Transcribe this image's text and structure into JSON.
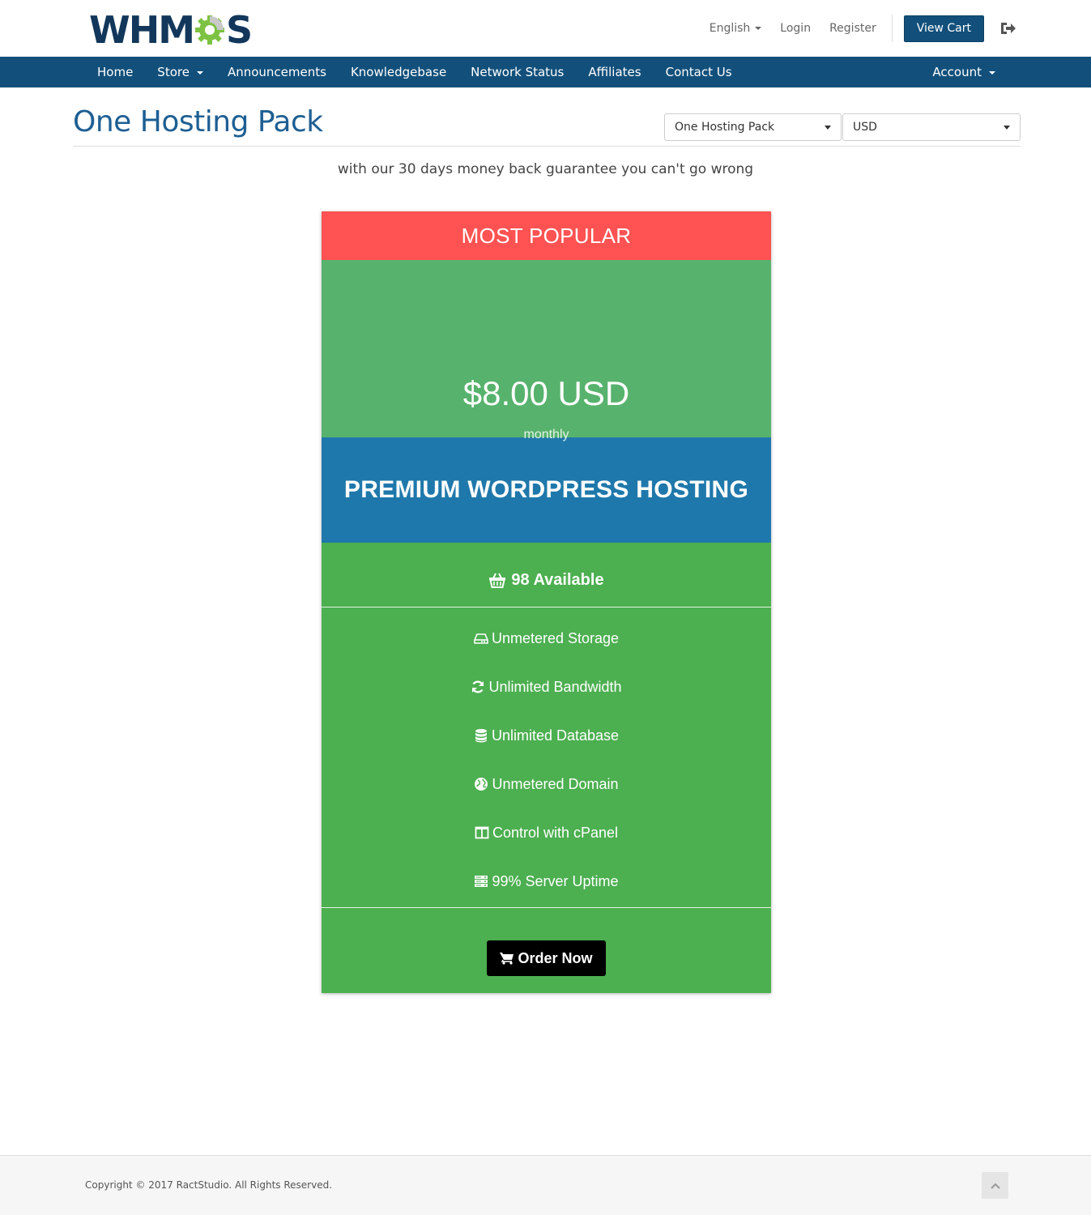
{
  "header": {
    "logo_text_left": "WHM",
    "logo_text_right": "S",
    "language": "English",
    "login": "Login",
    "register": "Register",
    "view_cart": "View Cart"
  },
  "nav": {
    "items": [
      {
        "label": "Home"
      },
      {
        "label": "Store"
      },
      {
        "label": "Announcements"
      },
      {
        "label": "Knowledgebase"
      },
      {
        "label": "Network Status"
      },
      {
        "label": "Affiliates"
      },
      {
        "label": "Contact Us"
      }
    ],
    "account": "Account"
  },
  "page": {
    "title": "One Hosting Pack",
    "group_select": "One Hosting Pack",
    "currency_select": "USD",
    "tagline": "with our 30 days money back guarantee you can't go wrong"
  },
  "product": {
    "badge": "MOST POPULAR",
    "price": "$8.00 USD",
    "cycle": "monthly",
    "name": "PREMIUM WORDPRESS HOSTING",
    "availability": "98 Available",
    "features": [
      {
        "icon": "hdd-icon",
        "label": "Unmetered Storage"
      },
      {
        "icon": "refresh-icon",
        "label": "Unlimited Bandwidth"
      },
      {
        "icon": "database-icon",
        "label": "Unlimited Database"
      },
      {
        "icon": "globe-icon",
        "label": "Unmetered Domain"
      },
      {
        "icon": "columns-icon",
        "label": "Control with cPanel"
      },
      {
        "icon": "server-icon",
        "label": "99% Server Uptime"
      }
    ],
    "order_button": "Order Now"
  },
  "footer": {
    "copyright": "Copyright © 2017 RactStudio. All Rights Reserved."
  },
  "colors": {
    "brand_blue": "#12507b",
    "badge_red": "#ff5252",
    "price_green": "#57b26d",
    "card_green": "#4caf50",
    "title_blue": "#1f78ab",
    "gear_green": "#7dc242"
  }
}
